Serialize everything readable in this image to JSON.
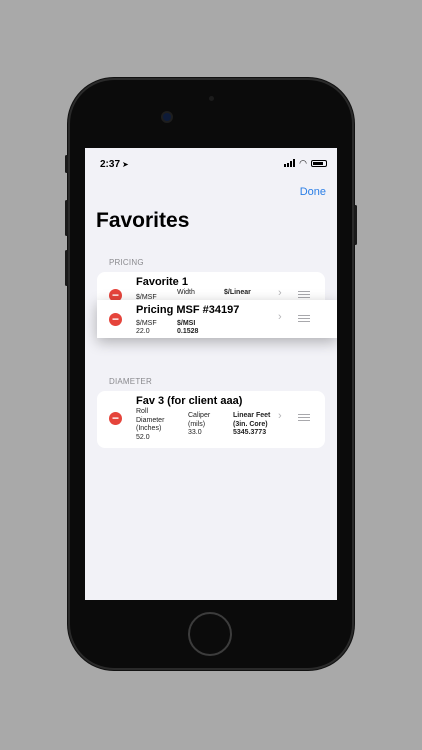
{
  "status_bar": {
    "time": "2:37",
    "location_icon": "location-arrow-icon"
  },
  "nav": {
    "done_label": "Done",
    "title": "Favorites"
  },
  "sections": [
    {
      "header": "PRICING",
      "rows": [
        {
          "title": "Favorite 1",
          "cells": [
            {
              "label": "$/MSF",
              "value": ""
            },
            {
              "label": "Width",
              "value": ""
            },
            {
              "label": "$/Linear",
              "value": ""
            }
          ]
        },
        {
          "title": "Pricing MSF #34197",
          "cells": [
            {
              "label": "$/MSF",
              "value": "22.0"
            },
            {
              "label": "$/MSI",
              "value": "0.1528"
            }
          ]
        }
      ]
    },
    {
      "header": "DIAMETER",
      "rows": [
        {
          "title": "Fav 3 (for client aaa)",
          "cells": [
            {
              "label": "Roll\nDiameter\n(Inches)",
              "value": "52.0"
            },
            {
              "label": "Caliper\n(mils)",
              "value": "33.0"
            },
            {
              "label": "Linear Feet\n(3in. Core)",
              "value": "5345.3773"
            }
          ]
        }
      ]
    }
  ]
}
